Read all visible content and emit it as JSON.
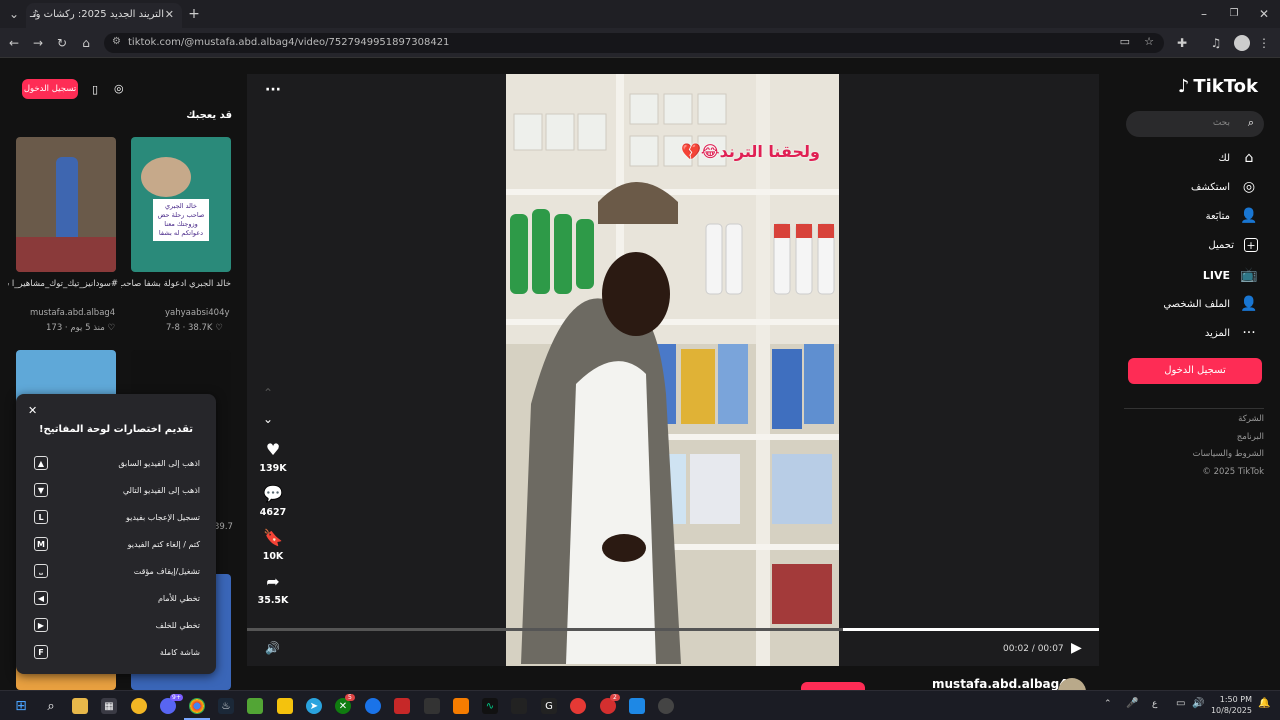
{
  "browser": {
    "tab_title": "التريند الجديد 2025: ركشات وتـ",
    "url": "tiktok.com/@mustafa.abd.albag4/video/7527949951897308421"
  },
  "sidebar": {
    "logo": "TikTok",
    "search_placeholder": "بحث",
    "items": [
      {
        "label": "لك",
        "icon": "home-icon"
      },
      {
        "label": "استكشف",
        "icon": "compass-icon"
      },
      {
        "label": "متابَعة",
        "icon": "following-icon"
      },
      {
        "label": "تحميل",
        "icon": "upload-icon"
      },
      {
        "label": "LIVE",
        "icon": "live-icon"
      },
      {
        "label": "الملف الشخصي",
        "icon": "profile-icon"
      },
      {
        "label": "المزيد",
        "icon": "more-icon"
      }
    ],
    "login_label": "تسجيل الدخول",
    "footer": [
      "الشركة",
      "البرنامج",
      "الشروط والسياسات",
      "© 2025 TikTok"
    ]
  },
  "video": {
    "overlay_text": "ولحقنا الترند😂💔",
    "likes": "139K",
    "comments": "4627",
    "bookmarks": "10K",
    "shares": "35.5K",
    "time_current": "00:02",
    "time_total": "00:07",
    "progress": 0.3,
    "author": "mustafa.abd.albag4"
  },
  "recommended": {
    "login_label": "تسجيل الدخول",
    "heading": "قد يعجبك",
    "cards": [
      {
        "caption": "خالد الجبري ادعولة بشفا صاحب رحلة حسن وزوجلك...",
        "author": "yahyaabsi404y",
        "likes": "38.7K",
        "date": "7-8",
        "thumb_text": "خالد الجبري صاحب رحلة حض وزوجتك معنا دعواتكم له بشفا"
      },
      {
        "caption": "#سودانيز_تيك_توك_مشاهير_ا سودانيز_تيك_تو..#_ سودان🇸🇩",
        "author": "mustafa.abd.albag4",
        "likes": "173",
        "date": "منذ 5 يوم"
      }
    ],
    "partial_likes": "39.7"
  },
  "shortcuts": {
    "title": "تقديم اختصارات لوحة المفاتيح!",
    "items": [
      {
        "key": "▲",
        "label": "اذهب إلى الفيديو السابق"
      },
      {
        "key": "▼",
        "label": "اذهب إلى الفيديو التالي"
      },
      {
        "key": "L",
        "label": "تسجيل الإعجاب بفيديو"
      },
      {
        "key": "M",
        "label": "كتم / إلغاء كتم الفيديو"
      },
      {
        "key": "⎵",
        "label": "تشغيل/إيقاف مؤقت"
      },
      {
        "key": "◀",
        "label": "تخطي للأمام"
      },
      {
        "key": "▶",
        "label": "تخطي للخلف"
      },
      {
        "key": "F",
        "label": "شاشة كاملة"
      }
    ]
  },
  "taskbar": {
    "time": "1:50 PM",
    "date": "10/8/2025",
    "lang": "ع",
    "badges": {
      "discord": "9+",
      "chat": "5",
      "opera": "2"
    }
  },
  "colors": {
    "accent": "#fe2c55",
    "bg": "#121212"
  }
}
